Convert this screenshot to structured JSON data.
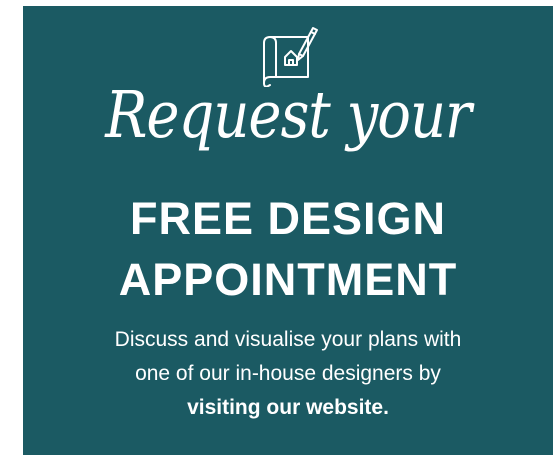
{
  "card": {
    "background_color": "#1b5a63",
    "text_color": "#ffffff",
    "icon": "blueprint-pencil-icon",
    "script_title": "Request your",
    "heading_line1": "FREE DESIGN",
    "heading_line2": "APPOINTMENT",
    "body_line1": "Discuss and visualise your plans with",
    "body_line2": "one of our in-house designers by",
    "link_text": "visiting our website."
  }
}
